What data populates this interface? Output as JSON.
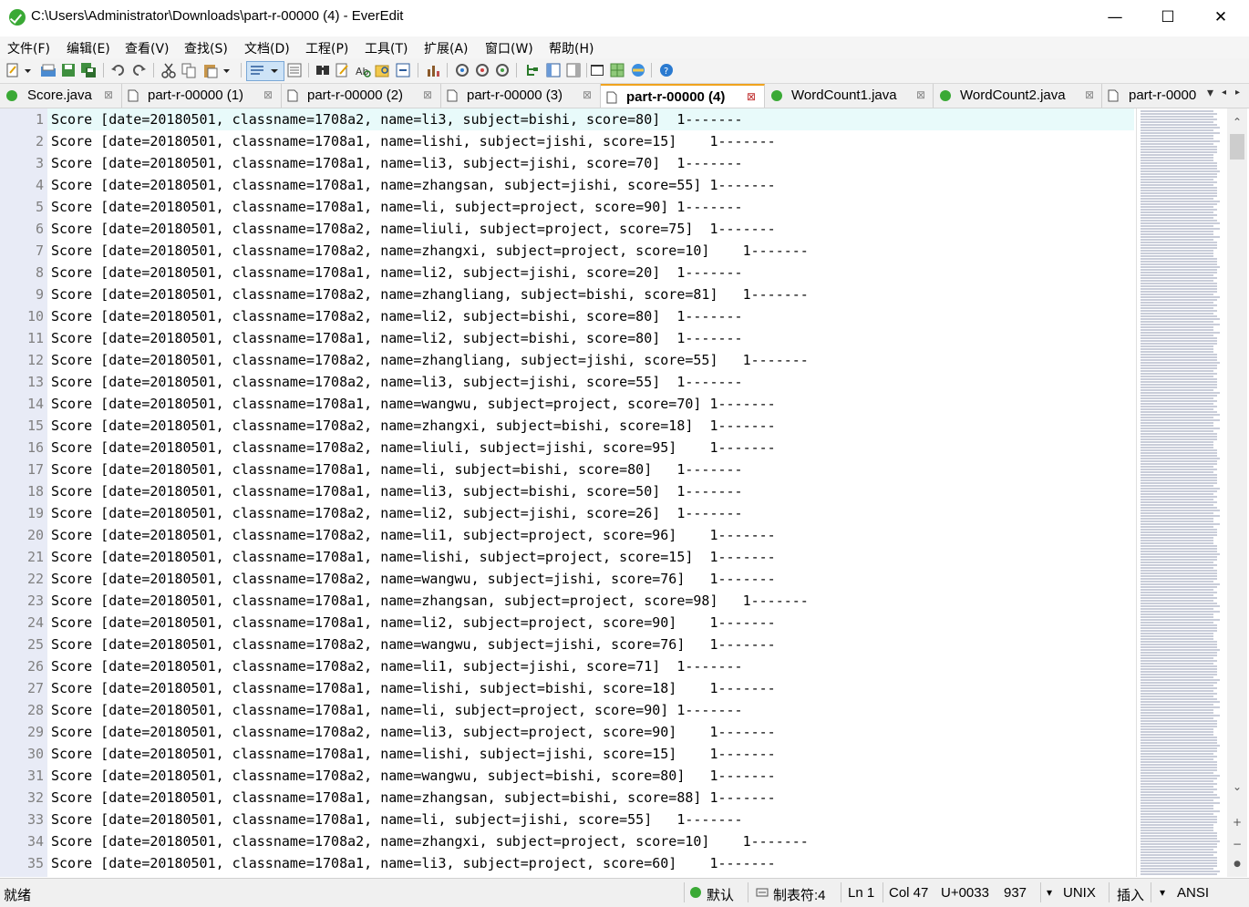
{
  "window": {
    "title": "C:\\Users\\Administrator\\Downloads\\part-r-00000 (4) - EverEdit",
    "minimize": "—",
    "maximize": "☐",
    "close": "✕"
  },
  "menu": [
    "文件(F)",
    "编辑(E)",
    "查看(V)",
    "查找(S)",
    "文档(D)",
    "工程(P)",
    "工具(T)",
    "扩展(A)",
    "窗口(W)",
    "帮助(H)"
  ],
  "tabs": [
    {
      "label": "Score.java",
      "icon": "java-file-icon",
      "active": false
    },
    {
      "label": "part-r-00000 (1)",
      "icon": "text-file-icon",
      "active": false
    },
    {
      "label": "part-r-00000 (2)",
      "icon": "text-file-icon",
      "active": false
    },
    {
      "label": "part-r-00000 (3)",
      "icon": "text-file-icon",
      "active": false
    },
    {
      "label": "part-r-00000 (4)",
      "icon": "text-file-icon",
      "active": true
    },
    {
      "label": "WordCount1.java",
      "icon": "java-file-icon",
      "active": false
    },
    {
      "label": "WordCount2.java",
      "icon": "java-file-icon",
      "active": false
    },
    {
      "label": "part-r-0000",
      "icon": "text-file-icon",
      "active": false
    }
  ],
  "tab_close_glyph": "⊠",
  "tab_list_glyph": "▾",
  "tab_left_glyph": "◂",
  "tab_right_glyph": "▸",
  "editor": {
    "lines": [
      "Score [date=20180501, classname=1708a2, name=li3, subject=bishi, score=80]  1-------",
      "Score [date=20180501, classname=1708a1, name=lishi, subject=jishi, score=15]    1-------",
      "Score [date=20180501, classname=1708a1, name=li3, subject=jishi, score=70]  1-------",
      "Score [date=20180501, classname=1708a1, name=zhangsan, subject=jishi, score=55] 1-------",
      "Score [date=20180501, classname=1708a1, name=li, subject=project, score=90] 1-------",
      "Score [date=20180501, classname=1708a2, name=liuli, subject=project, score=75]  1-------",
      "Score [date=20180501, classname=1708a2, name=zhangxi, subject=project, score=10]    1-------",
      "Score [date=20180501, classname=1708a1, name=li2, subject=jishi, score=20]  1-------",
      "Score [date=20180501, classname=1708a2, name=zhangliang, subject=bishi, score=81]   1-------",
      "Score [date=20180501, classname=1708a2, name=li2, subject=bishi, score=80]  1-------",
      "Score [date=20180501, classname=1708a1, name=li2, subject=bishi, score=80]  1-------",
      "Score [date=20180501, classname=1708a2, name=zhangliang, subject=jishi, score=55]   1-------",
      "Score [date=20180501, classname=1708a2, name=li3, subject=jishi, score=55]  1-------",
      "Score [date=20180501, classname=1708a1, name=wangwu, subject=project, score=70] 1-------",
      "Score [date=20180501, classname=1708a2, name=zhangxi, subject=bishi, score=18]  1-------",
      "Score [date=20180501, classname=1708a2, name=liuli, subject=jishi, score=95]    1-------",
      "Score [date=20180501, classname=1708a1, name=li, subject=bishi, score=80]   1-------",
      "Score [date=20180501, classname=1708a1, name=li3, subject=bishi, score=50]  1-------",
      "Score [date=20180501, classname=1708a2, name=li2, subject=jishi, score=26]  1-------",
      "Score [date=20180501, classname=1708a2, name=li1, subject=project, score=96]    1-------",
      "Score [date=20180501, classname=1708a1, name=lishi, subject=project, score=15]  1-------",
      "Score [date=20180501, classname=1708a2, name=wangwu, subject=jishi, score=76]   1-------",
      "Score [date=20180501, classname=1708a1, name=zhangsan, subject=project, score=98]   1-------",
      "Score [date=20180501, classname=1708a1, name=li2, subject=project, score=90]    1-------",
      "Score [date=20180501, classname=1708a2, name=wangwu, subject=jishi, score=76]   1-------",
      "Score [date=20180501, classname=1708a2, name=li1, subject=jishi, score=71]  1-------",
      "Score [date=20180501, classname=1708a1, name=lishi, subject=bishi, score=18]    1-------",
      "Score [date=20180501, classname=1708a1, name=li, subject=project, score=90] 1-------",
      "Score [date=20180501, classname=1708a2, name=li3, subject=project, score=90]    1-------",
      "Score [date=20180501, classname=1708a1, name=lishi, subject=jishi, score=15]    1-------",
      "Score [date=20180501, classname=1708a2, name=wangwu, subject=bishi, score=80]   1-------",
      "Score [date=20180501, classname=1708a1, name=zhangsan, subject=bishi, score=88] 1-------",
      "Score [date=20180501, classname=1708a1, name=li, subject=jishi, score=55]   1-------",
      "Score [date=20180501, classname=1708a2, name=zhangxi, subject=project, score=10]    1-------",
      "Score [date=20180501, classname=1708a1, name=li3, subject=project, score=60]    1-------"
    ]
  },
  "scrollbar": {
    "up": "⌃",
    "down": "⌄",
    "next": "+",
    "prev": "−",
    "dot": "●"
  },
  "status": {
    "ready": "就绪",
    "lint": "默认",
    "tab_setting": "制表符:4",
    "line": "Ln 1",
    "column": "Col 47",
    "unicode": "U+0033",
    "length": "937",
    "line_ending": "UNIX",
    "insert_mode": "插入",
    "encoding": "ANSI",
    "dropdown": "▾"
  },
  "colors": {
    "gutter": "#e8ebf6",
    "current_line": "#e8fafa",
    "active_tab_accent": "#f0a31e",
    "java_icon": "#3aa935"
  }
}
